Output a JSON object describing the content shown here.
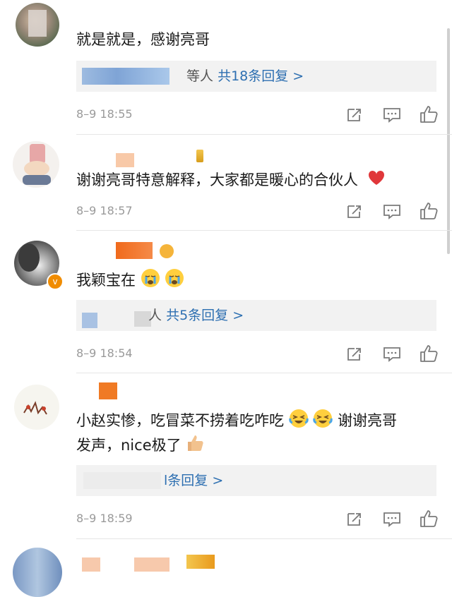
{
  "comments": [
    {
      "text": "就是就是，感谢亮哥",
      "time": "8–9 18:55",
      "reply": {
        "prefix": "等人",
        "link": "共18条回复 >"
      }
    },
    {
      "text": "谢谢亮哥特意解释，大家都是暖心的合伙人",
      "time": "8–9 18:57"
    },
    {
      "text": "我颖宝在",
      "time": "8–9 18:54",
      "reply": {
        "prefix": "人",
        "link": "共5条回复 >"
      }
    },
    {
      "text_line1": "小赵实惨，吃冒菜不捞着吃咋吃",
      "text_line1_tail": "谢谢亮哥",
      "text_line2": "发声，nice极了",
      "time": "8–9 18:59",
      "reply": {
        "link": "l条回复 >"
      }
    }
  ],
  "icons": [
    "share-icon",
    "comment-icon",
    "like-icon",
    "heart-icon",
    "crying-face-icon",
    "laughing-crying-icon",
    "thumbs-up-icon",
    "verified-badge-icon"
  ],
  "colors": {
    "link": "#2d6fb1",
    "time": "#9a9a9a",
    "heart": "#e0373a",
    "verified": "#f08c00"
  }
}
